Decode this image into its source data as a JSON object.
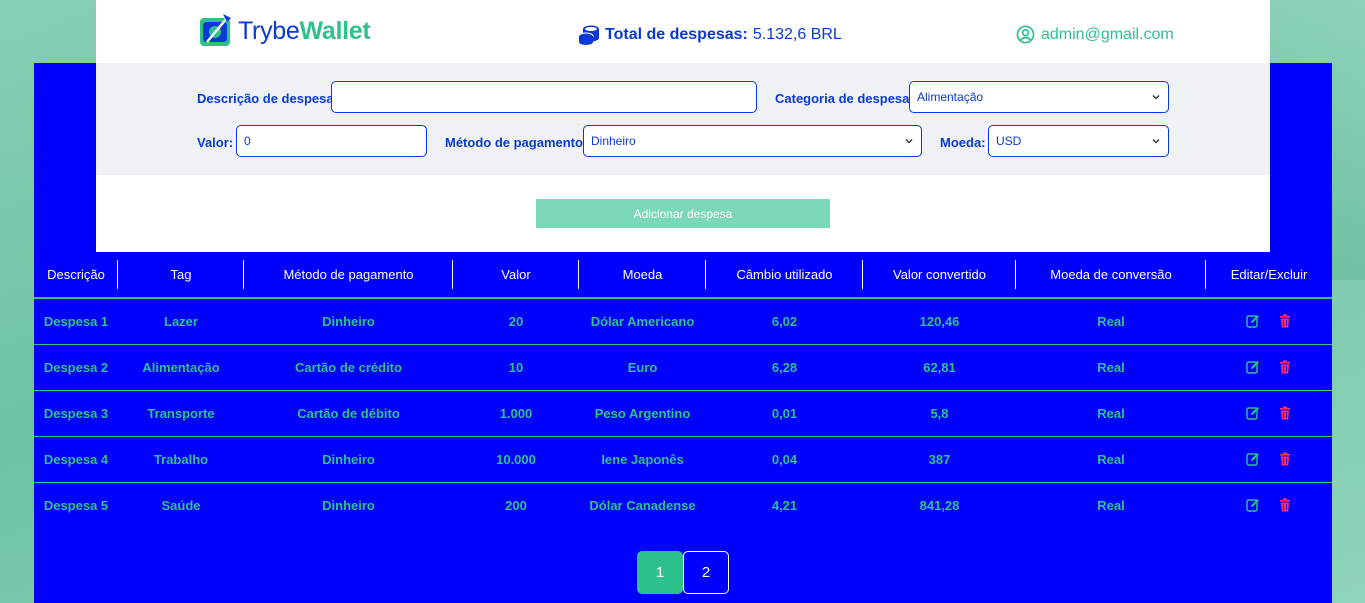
{
  "brand": {
    "prefix": "Trybe",
    "suffix": "Wallet"
  },
  "header": {
    "total_label": "Total de despesas:",
    "total_value": "5.132,6 BRL",
    "user_email": "admin@gmail.com"
  },
  "form": {
    "description_label": "Descrição de despesas:",
    "description_value": "",
    "category_label": "Categoria de despesas:",
    "category_value": "Alimentação",
    "value_label": "Valor:",
    "value_value": "0",
    "method_label": "Método de pagamento:",
    "method_value": "Dinheiro",
    "currency_label": "Moeda:",
    "currency_value": "USD",
    "add_button": "Adicionar despesa"
  },
  "table": {
    "headers": [
      "Descrição",
      "Tag",
      "Método de pagamento",
      "Valor",
      "Moeda",
      "Câmbio utilizado",
      "Valor convertido",
      "Moeda de conversão",
      "Editar/Excluir"
    ],
    "rows": [
      [
        "Despesa 1",
        "Lazer",
        "Dinheiro",
        "20",
        "Dólar Americano",
        "6,02",
        "120,46",
        "Real"
      ],
      [
        "Despesa 2",
        "Alimentação",
        "Cartão de crédito",
        "10",
        "Euro",
        "6,28",
        "62,81",
        "Real"
      ],
      [
        "Despesa 3",
        "Transporte",
        "Cartão de débito",
        "1.000",
        "Peso Argentino",
        "0,01",
        "5,8",
        "Real"
      ],
      [
        "Despesa 4",
        "Trabalho",
        "Dinheiro",
        "10.000",
        "Iene Japonês",
        "0,04",
        "387",
        "Real"
      ],
      [
        "Despesa 5",
        "Saúde",
        "Dinheiro",
        "200",
        "Dólar Canadense",
        "4,21",
        "841,28",
        "Real"
      ]
    ]
  },
  "pagination": {
    "pages": [
      "1",
      "2"
    ],
    "current": "1"
  },
  "colors": {
    "brand_blue": "#0a3ad6",
    "brand_green": "#2fc18c",
    "panel_blue": "#0000ff",
    "delete_red": "#ff2d6f"
  },
  "icons": [
    "coins-icon",
    "user-circle-icon",
    "edit-icon",
    "trash-icon",
    "chevron-down-icon"
  ]
}
